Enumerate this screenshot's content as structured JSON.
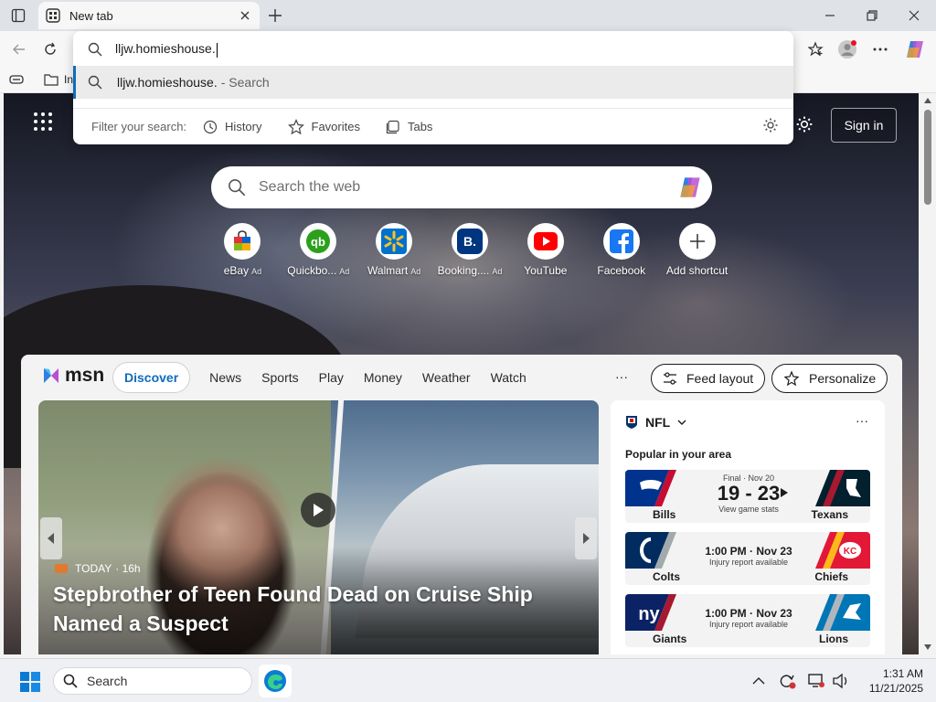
{
  "browser": {
    "tab_title": "New tab",
    "address_value": "lljw.homieshouse."
  },
  "omnibox": {
    "suggestion_text": "lljw.homieshouse.",
    "suggestion_hint": "- Search",
    "filter_label": "Filter your search:",
    "filters": [
      "History",
      "Favorites",
      "Tabs"
    ]
  },
  "favorites_bar": {
    "partial_item": "In"
  },
  "newtab": {
    "sign_in": "Sign in",
    "search_placeholder": "Search the web",
    "shortcuts": [
      {
        "label": "eBay",
        "ad": "Ad"
      },
      {
        "label": "Quickbo...",
        "ad": "Ad"
      },
      {
        "label": "Walmart",
        "ad": "Ad"
      },
      {
        "label": "Booking....",
        "ad": "Ad"
      },
      {
        "label": "YouTube",
        "ad": ""
      },
      {
        "label": "Facebook",
        "ad": ""
      },
      {
        "label": "Add shortcut",
        "ad": ""
      }
    ]
  },
  "feed": {
    "logo": "msn",
    "discover": "Discover",
    "nav": [
      "News",
      "Sports",
      "Play",
      "Money",
      "Weather",
      "Watch"
    ],
    "more": "···",
    "feed_layout": "Feed layout",
    "personalize": "Personalize",
    "hero": {
      "source": "TODAY",
      "time": "· 16h",
      "headline": "Stepbrother of Teen Found Dead on Cruise Ship Named a Suspect"
    },
    "nfl": {
      "title": "NFL",
      "more": "···",
      "popular": "Popular in your area",
      "games": [
        {
          "left": "Bills",
          "right": "Texans",
          "top": "Final · Nov 20",
          "main": "19 - 23",
          "sub": "View game stats",
          "left_color": "#00338d",
          "right_color": "#03202f"
        },
        {
          "left": "Colts",
          "right": "Chiefs",
          "top": "",
          "main": "1:00 PM · Nov 23",
          "sub": "Injury report available",
          "left_color": "#002c5f",
          "right_color": "#e31837"
        },
        {
          "left": "Giants",
          "right": "Lions",
          "top": "",
          "main": "1:00 PM · Nov 23",
          "sub": "Injury report available",
          "left_color": "#0b2265",
          "right_color": "#0076b6"
        }
      ]
    }
  },
  "taskbar": {
    "search_label": "Search",
    "time": "1:31 AM",
    "date": "11/21/2025"
  },
  "colors": {
    "accent": "#0f6cbd"
  }
}
